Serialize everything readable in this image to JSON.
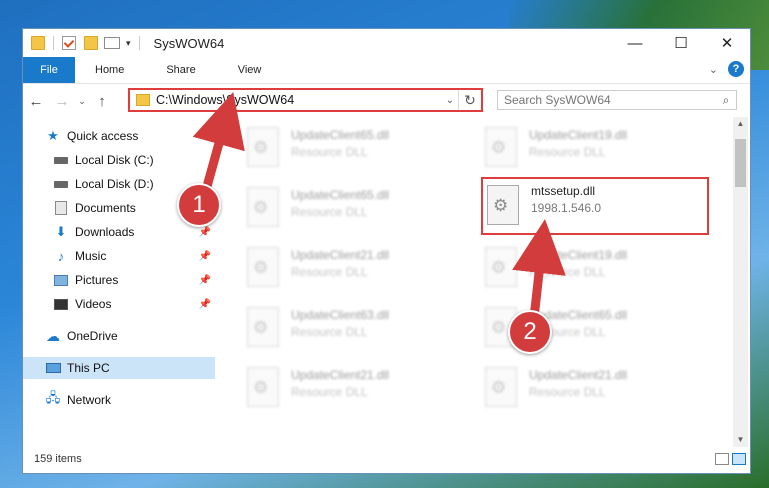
{
  "window": {
    "title": "SysWOW64",
    "controls": {
      "minimize": "—",
      "maximize": "☐",
      "close": "✕"
    }
  },
  "ribbon": {
    "tabs": [
      "File",
      "Home",
      "Share",
      "View"
    ],
    "expand": "⌄",
    "help": "?"
  },
  "nav": {
    "back": "←",
    "forward": "→",
    "recent": "⌄",
    "up": "↑"
  },
  "address": {
    "path": "C:\\Windows\\SysWOW64",
    "dropdown": "⌄",
    "refresh": "↻"
  },
  "search": {
    "placeholder": "Search SysWOW64",
    "icon": "search-icon"
  },
  "sidebar": {
    "items": [
      {
        "label": "Quick access",
        "icon": "star-icon",
        "pinned": false
      },
      {
        "label": "Local Disk (C:)",
        "icon": "disk-icon",
        "pinned": false
      },
      {
        "label": "Local Disk (D:)",
        "icon": "disk-icon",
        "pinned": false
      },
      {
        "label": "Documents",
        "icon": "documents-icon",
        "pinned": true
      },
      {
        "label": "Downloads",
        "icon": "download-icon",
        "pinned": true
      },
      {
        "label": "Music",
        "icon": "music-icon",
        "pinned": true
      },
      {
        "label": "Pictures",
        "icon": "pictures-icon",
        "pinned": true
      },
      {
        "label": "Videos",
        "icon": "videos-icon",
        "pinned": true
      },
      {
        "label": "OneDrive",
        "icon": "cloud-icon",
        "pinned": false
      },
      {
        "label": "This PC",
        "icon": "pc-icon",
        "pinned": false,
        "selected": true
      },
      {
        "label": "Network",
        "icon": "network-icon",
        "pinned": false
      }
    ]
  },
  "files": [
    {
      "name": "UpdateClient65.dll",
      "desc": "Resource DLL"
    },
    {
      "name": "UpdateClient19.dll",
      "desc": "Resource DLL"
    },
    {
      "name": "UpdateClient65.dll",
      "desc": "Resource DLL"
    },
    {
      "name": "mtssetup.dll",
      "desc": "1998.1.546.0"
    },
    {
      "name": "UpdateClient21.dll",
      "desc": "Resource DLL"
    },
    {
      "name": "UpdateClient19.dll",
      "desc": "Resource DLL"
    },
    {
      "name": "UpdateClient63.dll",
      "desc": "Resource DLL"
    },
    {
      "name": "UpdateClient65.dll",
      "desc": "Resource DLL"
    },
    {
      "name": "UpdateClient21.dll",
      "desc": "Resource DLL"
    },
    {
      "name": "UpdateClient21.dll",
      "desc": "Resource DLL"
    }
  ],
  "status": {
    "count": "159 items"
  },
  "callouts": [
    {
      "label": "1"
    },
    {
      "label": "2"
    }
  ],
  "colors": {
    "accent": "#1979ca",
    "highlight": "#e03c3c",
    "selected_bg": "#cce4f7"
  }
}
